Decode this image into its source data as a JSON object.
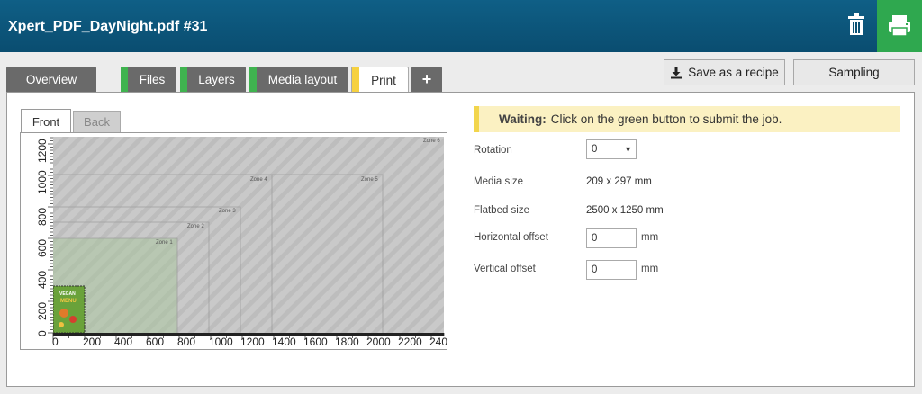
{
  "header": {
    "title": "Xpert_PDF_DayNight.pdf #31"
  },
  "tabs": [
    {
      "label": "Overview"
    },
    {
      "label": "Files",
      "stripe": "#3fb34f"
    },
    {
      "label": "Layers",
      "stripe": "#3fb34f"
    },
    {
      "label": "Media layout",
      "stripe": "#3fb34f"
    },
    {
      "label": "Print",
      "stripe": "#f6d140",
      "active": true
    },
    {
      "label": "+"
    }
  ],
  "toolbar": {
    "save_recipe": "Save as a recipe",
    "sampling": "Sampling"
  },
  "preview": {
    "tabs": {
      "front": "Front",
      "back": "Back"
    },
    "x_ticks": [
      "0",
      "200",
      "400",
      "600",
      "800",
      "1000",
      "1200",
      "1400",
      "1600",
      "1800",
      "2000",
      "2200",
      "240"
    ],
    "y_ticks": [
      "0",
      "200",
      "400",
      "600",
      "800",
      "1000",
      "1200"
    ],
    "zones": [
      "Zone 1",
      "Zone 2",
      "Zone 3",
      "Zone 4",
      "Zone 5",
      "Zone 6"
    ],
    "thumbnail_text": [
      "VEGAN",
      "MENU"
    ]
  },
  "status": {
    "label": "Waiting:",
    "message": "Click on the green button to submit the job."
  },
  "settings": {
    "rotation": {
      "label": "Rotation",
      "value": "0"
    },
    "media_size": {
      "label": "Media size",
      "value": "209 x 297 mm"
    },
    "flatbed_size": {
      "label": "Flatbed size",
      "value": "2500 x 1250 mm"
    },
    "horizontal_offset": {
      "label": "Horizontal offset",
      "value": "0",
      "unit": "mm"
    },
    "vertical_offset": {
      "label": "Vertical offset",
      "value": "0",
      "unit": "mm"
    }
  },
  "colors": {
    "header": "#0b5275",
    "print_button": "#2fa84f",
    "files_stripe": "#3fb34f",
    "print_stripe": "#f6d140"
  }
}
